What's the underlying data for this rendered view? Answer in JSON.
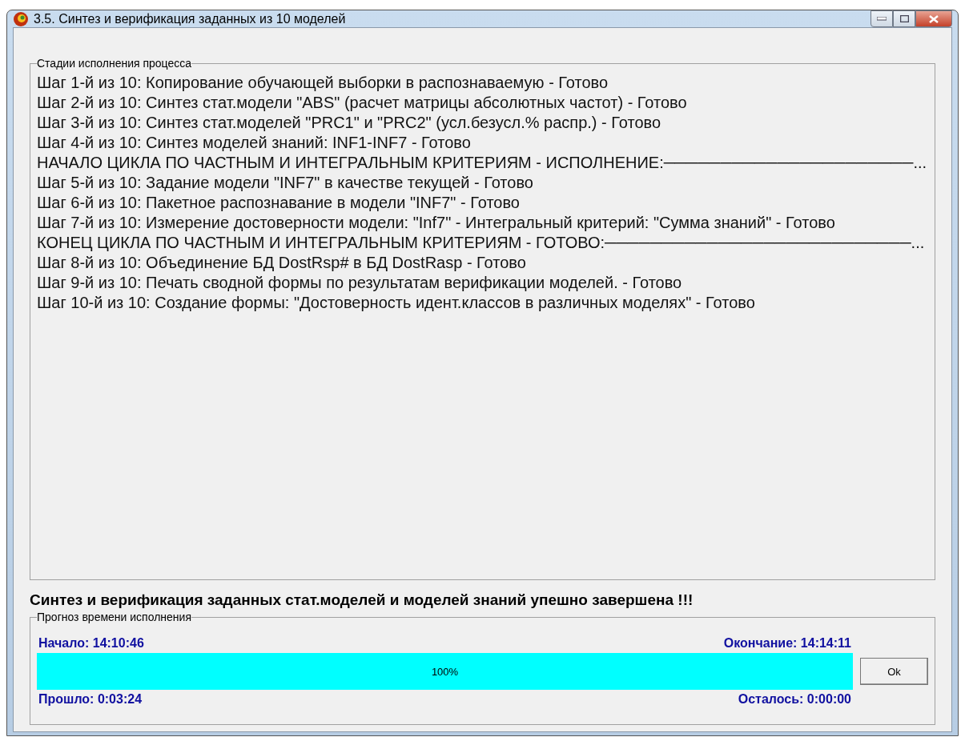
{
  "window": {
    "title": "3.5. Синтез и верификация заданных из 10 моделей"
  },
  "stages": {
    "legend": "Стадии исполнения процесса",
    "lines": [
      "Шаг 1-й из 10: Копирование обучающей выборки в распознаваемую - Готово",
      "Шаг 2-й из 10: Синтез стат.модели \"ABS\" (расчет матрицы абсолютных частот) - Готово",
      "Шаг 3-й из 10: Синтез стат.моделей \"PRC1\" и \"PRC2\" (усл.безусл.% распр.) - Готово",
      "Шаг 4-й из 10: Синтез моделей знаний: INF1-INF7 - Готово",
      "НАЧАЛО ЦИКЛА ПО ЧАСТНЫМ И ИНТЕГРАЛЬНЫМ КРИТЕРИЯМ - ИСПОЛНЕНИЕ:──────────────────────...",
      "Шаг 5-й из 10: Задание модели \"INF7\" в качестве текущей - Готово",
      "Шаг 6-й из 10: Пакетное распознавание в модели \"INF7\" - Готово",
      "Шаг 7-й из 10: Измерение достоверности модели: \"Inf7\" - Интегральный критерий: \"Сумма знаний\" - Готово",
      "КОНЕЦ ЦИКЛА ПО ЧАСТНЫМ И ИНТЕГРАЛЬНЫМ КРИТЕРИЯМ - ГОТОВО:───────────────────────────...",
      "Шаг 8-й из 10: Объединение БД DostRsp# в БД DostRasp - Готово",
      "Шаг 9-й из 10: Печать сводной формы по результатам верификации моделей. - Готово",
      "Шаг 10-й из 10: Создание формы: \"Достоверность идент.классов в различных моделях\" - Готово"
    ]
  },
  "message": "Синтез и верификация заданных стат.моделей и моделей знаний упешно завершена !!!",
  "forecast": {
    "legend": "Прогноз времени исполнения",
    "start": "Начало: 14:10:46",
    "end": "Окончание: 14:14:11",
    "progress": {
      "level": 1,
      "label": "100%"
    },
    "elapsed": "Прошло: 0:03:24",
    "remaining": "Осталось: 0:00:00"
  },
  "ok_button": "Ok"
}
